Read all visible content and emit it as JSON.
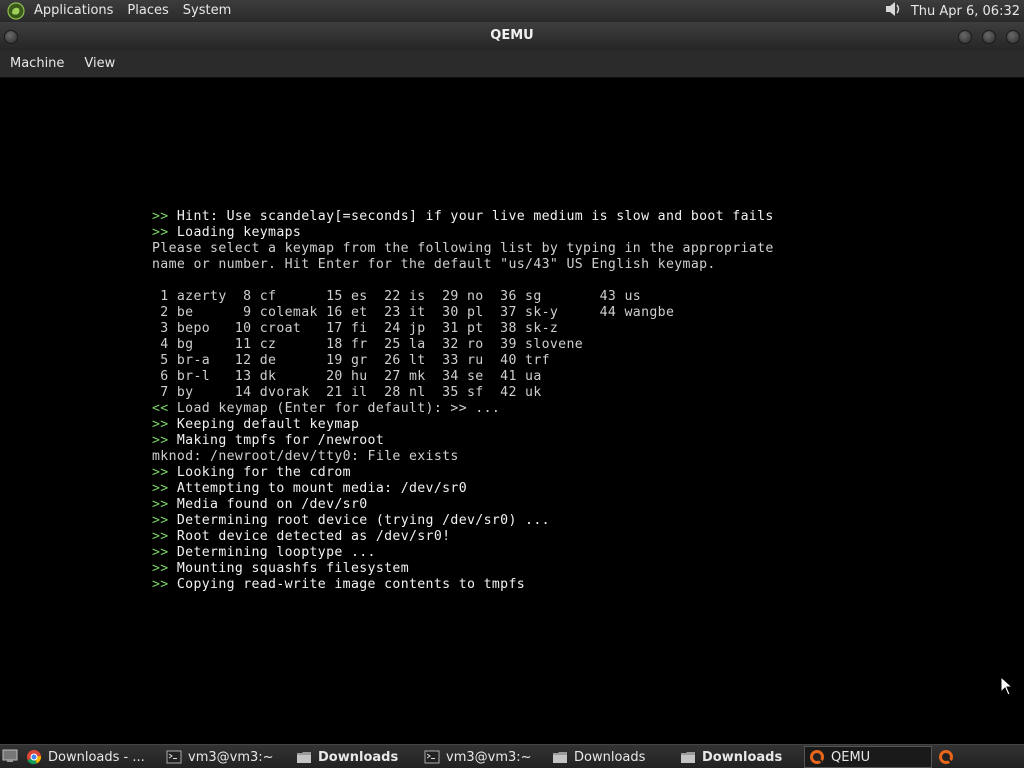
{
  "top_panel": {
    "menus": [
      "Applications",
      "Places",
      "System"
    ],
    "clock": "Thu Apr  6, 06:32"
  },
  "window": {
    "title": "QEMU",
    "menus": [
      "Machine",
      "View"
    ]
  },
  "console": {
    "lines": [
      {
        "prefix": ">> ",
        "text": "Hint: Use scandelay[=seconds] if your live medium is slow and boot fails"
      },
      {
        "prefix": ">> ",
        "text": "Loading keymaps"
      },
      {
        "prefix": "",
        "text": "Please select a keymap from the following list by typing in the appropriate"
      },
      {
        "prefix": "",
        "text": "name or number. Hit Enter for the default \"us/43\" US English keymap."
      },
      {
        "prefix": "",
        "text": ""
      },
      {
        "prefix": "",
        "text": " 1 azerty  8 cf      15 es  22 is  29 no  36 sg       43 us"
      },
      {
        "prefix": "",
        "text": " 2 be      9 colemak 16 et  23 it  30 pl  37 sk-y     44 wangbe"
      },
      {
        "prefix": "",
        "text": " 3 bepo   10 croat   17 fi  24 jp  31 pt  38 sk-z"
      },
      {
        "prefix": "",
        "text": " 4 bg     11 cz      18 fr  25 la  32 ro  39 slovene"
      },
      {
        "prefix": "",
        "text": " 5 br-a   12 de      19 gr  26 lt  33 ru  40 trf"
      },
      {
        "prefix": "",
        "text": " 6 br-l   13 dk      20 hu  27 mk  34 se  41 ua"
      },
      {
        "prefix": "",
        "text": " 7 by     14 dvorak  21 il  28 nl  35 sf  42 uk"
      },
      {
        "prefix": "<< ",
        "text": "Load keymap (Enter for default): >> ..."
      },
      {
        "prefix": ">> ",
        "text": "Keeping default keymap"
      },
      {
        "prefix": ">> ",
        "text": "Making tmpfs for /newroot"
      },
      {
        "prefix": "",
        "text": "mknod: /newroot/dev/tty0: File exists"
      },
      {
        "prefix": ">> ",
        "text": "Looking for the cdrom"
      },
      {
        "prefix": ">> ",
        "text": "Attempting to mount media: /dev/sr0"
      },
      {
        "prefix": ">> ",
        "text": "Media found on /dev/sr0"
      },
      {
        "prefix": ">> ",
        "text": "Determining root device (trying /dev/sr0) ..."
      },
      {
        "prefix": ">> ",
        "text": "Root device detected as /dev/sr0!"
      },
      {
        "prefix": ">> ",
        "text": "Determining looptype ..."
      },
      {
        "prefix": ">> ",
        "text": "Mounting squashfs filesystem"
      },
      {
        "prefix": ">> ",
        "text": "Copying read-write image contents to tmpfs"
      }
    ]
  },
  "taskbar": {
    "tasks": [
      {
        "label": "Downloads - ...",
        "icon": "chrome-icon",
        "bold": false,
        "active": false
      },
      {
        "label": "vm3@vm3:~",
        "icon": "terminal-icon",
        "bold": false,
        "active": false
      },
      {
        "label": "Downloads",
        "icon": "folder-icon",
        "bold": true,
        "active": false
      },
      {
        "label": "vm3@vm3:~",
        "icon": "terminal-icon",
        "bold": false,
        "active": false
      },
      {
        "label": "Downloads",
        "icon": "folder-icon",
        "bold": false,
        "active": false
      },
      {
        "label": "Downloads",
        "icon": "folder-icon",
        "bold": true,
        "active": false
      },
      {
        "label": "QEMU",
        "icon": "qemu-icon",
        "bold": false,
        "active": true
      },
      {
        "label": "",
        "icon": "qemu-icon",
        "bold": false,
        "active": false
      }
    ]
  }
}
